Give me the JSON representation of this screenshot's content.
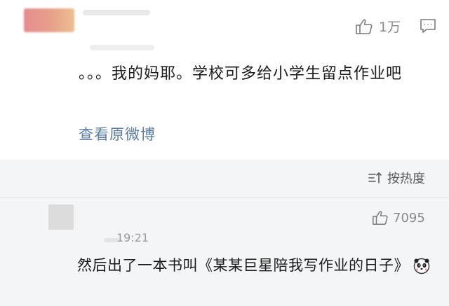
{
  "post": {
    "like_count": "1万",
    "text": "。。。我的妈耶。学校可多给小学生留点作业吧",
    "view_original": "查看原微博"
  },
  "sort": {
    "label": "按热度"
  },
  "reply": {
    "like_count": "7095",
    "time": "19:21",
    "text": "然后出了一本书叫《某某巨星陪我写作业的日子》",
    "emoji": "panda-face-icon"
  },
  "icons": {
    "like": "thumbs-up-icon",
    "comment": "comment-icon",
    "sort": "sort-icon"
  },
  "colors": {
    "link": "#5b7da8",
    "secondary_text": "#8a8a8a",
    "background_gray": "#f4f5f7"
  }
}
